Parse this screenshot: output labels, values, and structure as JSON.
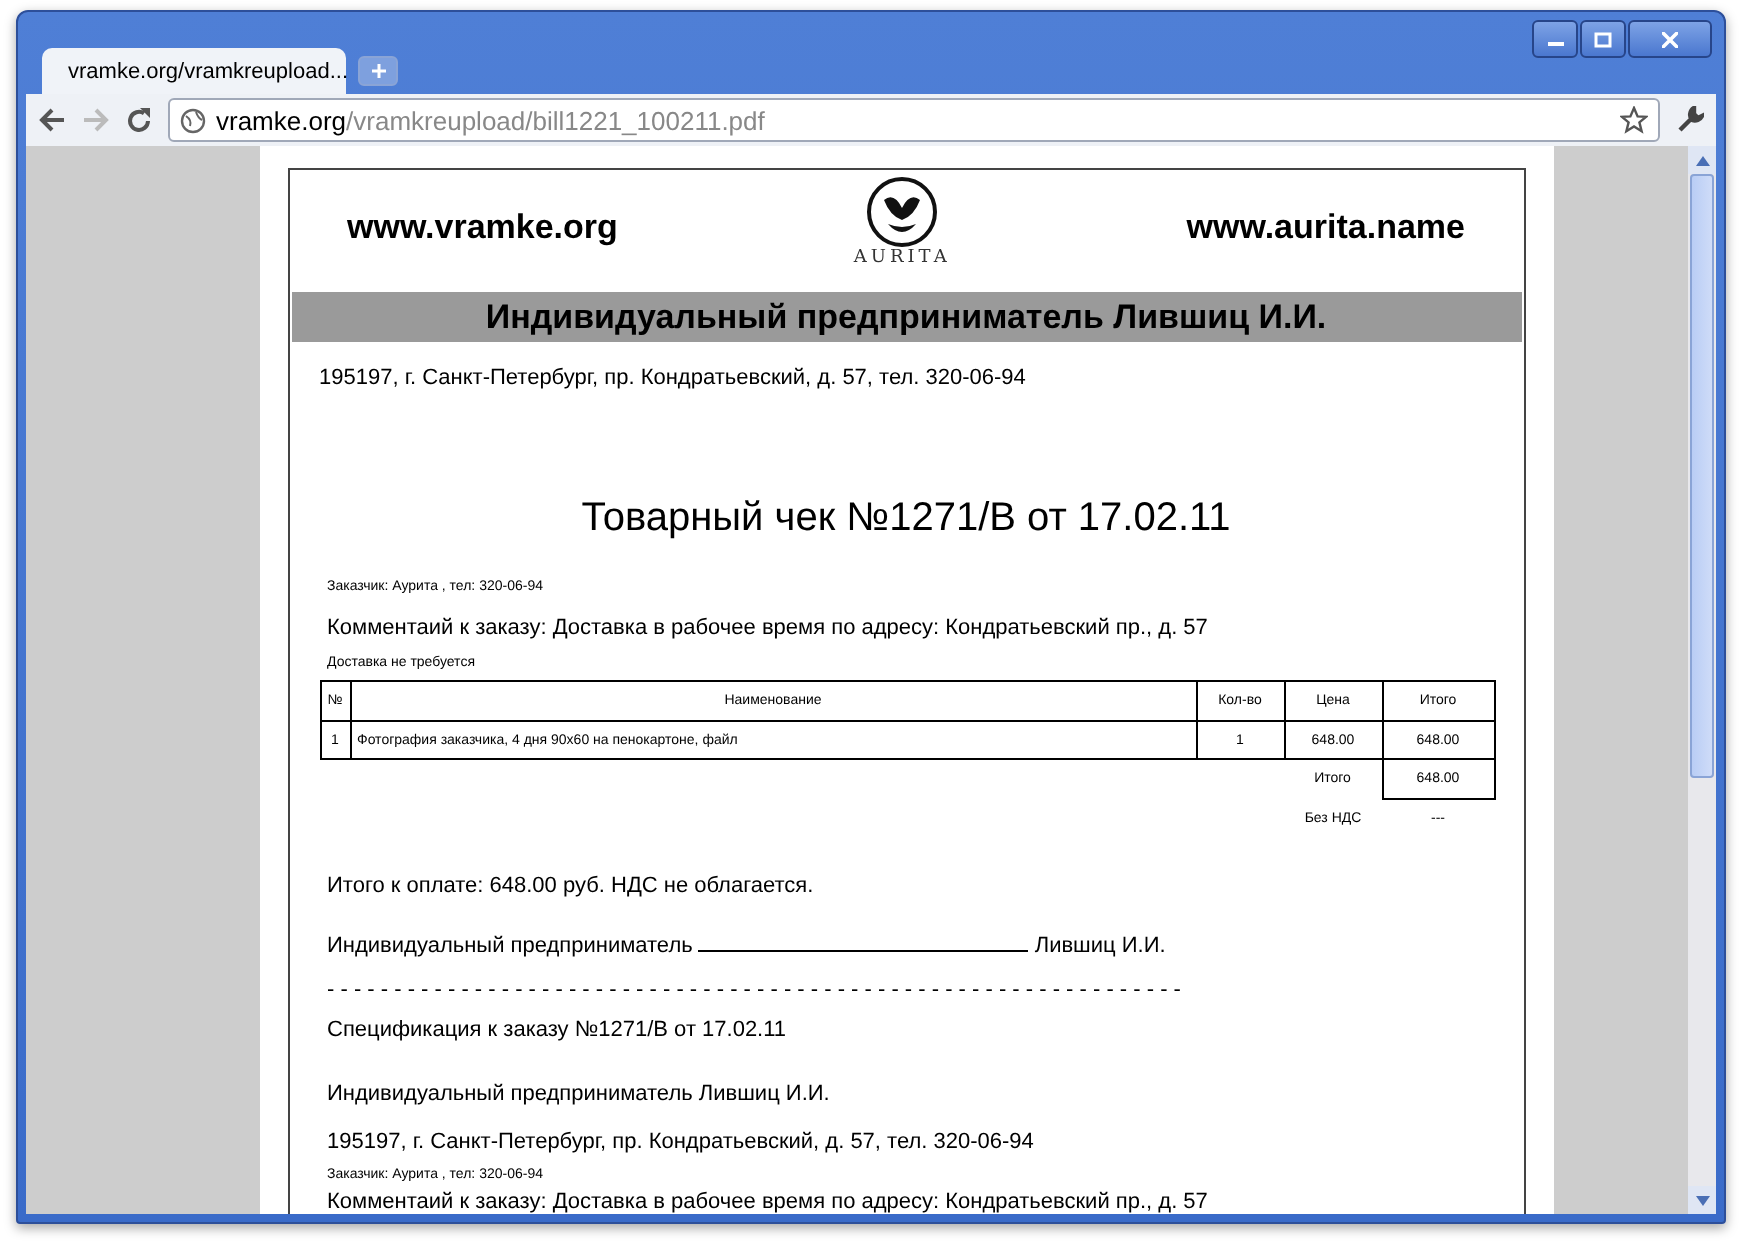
{
  "browser": {
    "tabs": [
      {
        "title": "vramke.org/vramkreupload...",
        "selected": true
      }
    ],
    "address": {
      "host": "vramke.org",
      "path": "/vramkreupload/bill1221_100211.pdf"
    }
  },
  "document": {
    "header": {
      "left_site": "www.vramke.org",
      "logo_text": "AURITA",
      "right_site": "www.aurita.name"
    },
    "seller_banner": "Индивидуальный предприниматель Лившиц И.И.",
    "seller_address": "195197, г. Санкт-Петербург, пр. Кондратьевский, д. 57, тел. 320-06-94",
    "title": "Товарный чек №1271/В от 17.02.11",
    "customer": "Заказчик: Аурита , тел: 320-06-94",
    "comment": "Комментаий к заказу: Доставка в рабочее время по адресу: Кондратьевский пр., д. 57",
    "delivery": "Доставка не требуется",
    "table": {
      "columns": [
        "№",
        "Наименование",
        "Кол-во",
        "Цена",
        "Итого"
      ],
      "rows": [
        [
          "1",
          "Фотография заказчика, 4 дня 90х60 на пенокартоне, файл",
          "1",
          "648.00",
          "648.00"
        ]
      ],
      "summary": [
        {
          "label": "Итого",
          "value": "648.00",
          "boxed": true
        },
        {
          "label": "Без НДС",
          "value": "---",
          "boxed": false
        }
      ]
    },
    "total_text": "Итого к оплате: 648.00 руб. НДС не облагается.",
    "signature": {
      "role": "Индивидуальный предприниматель",
      "name": "Лившиц И.И."
    },
    "separator": "- - - - - - - - - - - - - - - - - - - - - - - - - - - - - - - - - - - - - - - - - - - - - - - - - - - - - - - - - - - - - - - -",
    "spec_title": "Спецификация к заказу №1271/В от 17.02.11",
    "spec_seller": "Индивидуальный предприниматель Лившиц И.И.",
    "spec_address": "195197, г. Санкт-Петербург, пр. Кондратьевский, д. 57, тел. 320-06-94",
    "spec_customer": "Заказчик: Аурита , тел: 320-06-94",
    "spec_comment": "Комментаий к заказу: Доставка в рабочее время по адресу: Кондратьевский пр., д. 57"
  }
}
